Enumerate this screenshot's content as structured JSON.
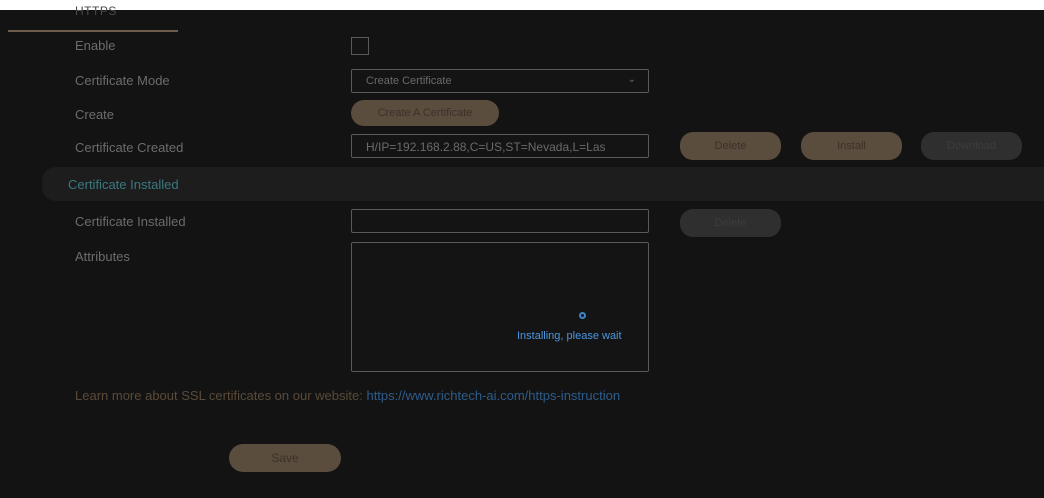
{
  "section": {
    "tab_label": "HTTPS"
  },
  "form": {
    "enable_label": "Enable",
    "enable_checked": false,
    "mode_label": "Certificate Mode",
    "mode_value": "Create Certificate",
    "create_label": "Create",
    "create_button": "Create A Certificate",
    "created_label": "Certificate Created",
    "created_value": "H/IP=192.168.2.88,C=US,ST=Nevada,L=Las",
    "delete_button": "Delete",
    "install_button": "Install",
    "download_button": "Download"
  },
  "installed_section": {
    "title": "Certificate Installed",
    "installed_label": "Certificate Installed",
    "installed_value": "",
    "delete_button": "Delete",
    "attributes_label": "Attributes",
    "loading_text": "Installing, please wait"
  },
  "footer": {
    "learn_text": "Learn more about SSL certificates on our website:",
    "learn_link": "https://www.richtech-ai.com/https-instruction",
    "save_button": "Save"
  },
  "colors": {
    "accent_gold": "#5b4d3e",
    "link_blue": "#2e5c8c",
    "section_teal": "#3a7880",
    "loading_blue": "#4b97df"
  }
}
